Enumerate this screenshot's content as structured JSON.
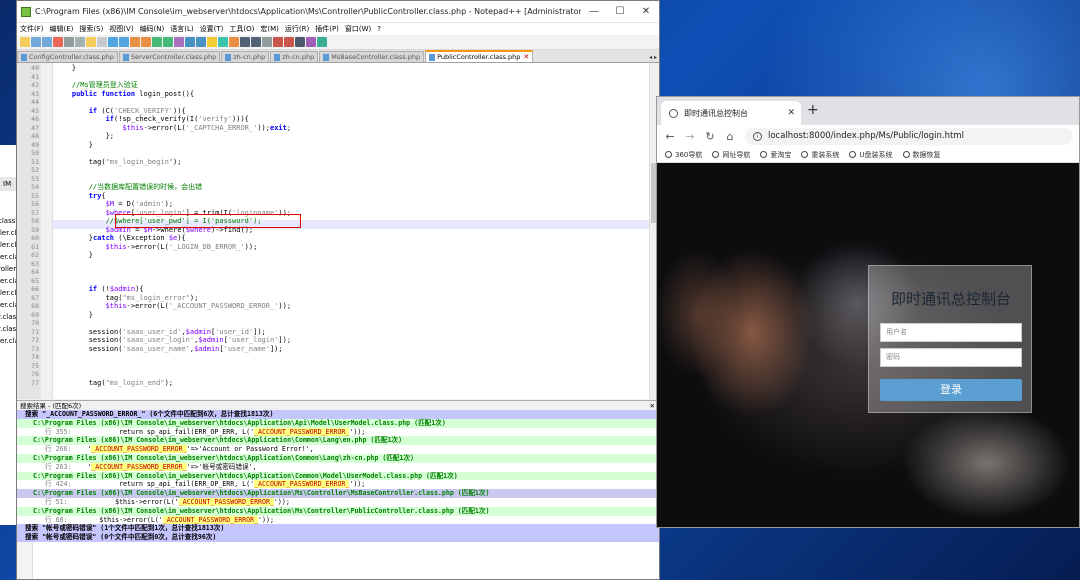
{
  "notepad": {
    "title": "C:\\Program Files (x86)\\IM Console\\im_webserver\\htdocs\\Application\\Ms\\Controller\\PublicController.class.php - Notepad++ [Administrator]",
    "menus": [
      "文件(F)",
      "编辑(E)",
      "搜索(S)",
      "视图(V)",
      "编码(N)",
      "语言(L)",
      "设置(T)",
      "工具(O)",
      "宏(M)",
      "运行(R)",
      "插件(P)",
      "窗口(W)",
      "?"
    ],
    "tabs": [
      "ConfigController.class.php",
      "ServerController.class.php",
      "zh-cn.php",
      "zh-cn.php",
      "MsBaseController.class.php",
      "PublicController.class.php"
    ],
    "tab_nav": "◂ ▸",
    "window_buttons": {
      "minimize": "—",
      "maximize": "☐",
      "close": "✕"
    },
    "code_lines": [
      {
        "n": "40",
        "t": "    }"
      },
      {
        "n": "41",
        "t": ""
      },
      {
        "n": "42",
        "t": "    //Ms管理员登入验证"
      },
      {
        "n": "43",
        "t": "    public function login_post(){"
      },
      {
        "n": "44",
        "t": ""
      },
      {
        "n": "45",
        "t": "        if (C('CHECK_VERIFY')){"
      },
      {
        "n": "46",
        "t": "            if(!sp_check_verify(I('verify'))){"
      },
      {
        "n": "47",
        "t": "                $this->error(L('_CAPTCHA_ERROR_'));exit;"
      },
      {
        "n": "48",
        "t": "            };"
      },
      {
        "n": "49",
        "t": "        }"
      },
      {
        "n": "50",
        "t": ""
      },
      {
        "n": "51",
        "t": "        tag(\"ms_login_begin\");"
      },
      {
        "n": "52",
        "t": ""
      },
      {
        "n": "53",
        "t": ""
      },
      {
        "n": "54",
        "t": "        //当数据库配置错误的时候，会出错"
      },
      {
        "n": "55",
        "t": "        try{"
      },
      {
        "n": "56",
        "t": "            $M = D('admin');"
      },
      {
        "n": "57",
        "t": "            $where['user_login'] = trim(I('loginname'));"
      },
      {
        "n": "58",
        "t": "            //$where['user_pwd'] = I('password');"
      },
      {
        "n": "59",
        "t": "            $admin = $M->where($where)->find();"
      },
      {
        "n": "60",
        "t": "        }catch (\\Exception $e){"
      },
      {
        "n": "61",
        "t": "            $this->error(L('_LOGIN_DB_ERROR_'));"
      },
      {
        "n": "62",
        "t": "        }"
      },
      {
        "n": "63",
        "t": ""
      },
      {
        "n": "64",
        "t": ""
      },
      {
        "n": "65",
        "t": ""
      },
      {
        "n": "66",
        "t": "        if (!$admin){"
      },
      {
        "n": "67",
        "t": "            tag(\"ms_login_error\");"
      },
      {
        "n": "68",
        "t": "            $this->error(L('_ACCOUNT_PASSWORD_ERROR_'));"
      },
      {
        "n": "69",
        "t": "        }"
      },
      {
        "n": "70",
        "t": ""
      },
      {
        "n": "71",
        "t": "        session('saas_user_id',$admin['user_id']);"
      },
      {
        "n": "72",
        "t": "        session('saas_user_login',$admin['user_login']);"
      },
      {
        "n": "73",
        "t": "        session('saas_user_name',$admin['user_name']);"
      },
      {
        "n": "74",
        "t": ""
      },
      {
        "n": "75",
        "t": ""
      },
      {
        "n": "76",
        "t": ""
      },
      {
        "n": "77",
        "t": "        tag(\"ms_login_end\");"
      }
    ],
    "find_panel_title": "搜索结果 - (匹配6次)",
    "find_panel_close": "✕",
    "results": [
      {
        "kind": "search",
        "text": "搜索 \"_ACCOUNT_PASSWORD_ERROR_\" (6个文件中匹配到6次，总计查找1813次)"
      },
      {
        "kind": "file",
        "text": "C:\\Program Files (x86)\\IM Console\\im_webserver\\htdocs\\Application\\Api\\Model\\UserModel.class.php (匹配1次)"
      },
      {
        "kind": "line",
        "lno": "行 355:",
        "pre": "            return sp_api_fail(ERR_OP_ERR, L('",
        "match": "_ACCOUNT_PASSWORD_ERROR_",
        "post": "'));"
      },
      {
        "kind": "file",
        "text": "C:\\Program Files (x86)\\IM Console\\im_webserver\\htdocs\\Application\\Common\\Lang\\en.php (匹配1次)"
      },
      {
        "kind": "line",
        "lno": "行 266:",
        "pre": "    '",
        "match": "_ACCOUNT_PASSWORD_ERROR_",
        "post": "'=>'Account or Password Error!',"
      },
      {
        "kind": "file",
        "text": "C:\\Program Files (x86)\\IM Console\\im_webserver\\htdocs\\Application\\Common\\Lang\\zh-cn.php (匹配1次)"
      },
      {
        "kind": "line",
        "lno": "行 263:",
        "pre": "    '",
        "match": "_ACCOUNT_PASSWORD_ERROR_",
        "post": "'=>'帐号或密码错误',"
      },
      {
        "kind": "file",
        "text": "C:\\Program Files (x86)\\IM Console\\im_webserver\\htdocs\\Application\\Common\\Model\\UserModel.class.php (匹配1次)"
      },
      {
        "kind": "line",
        "lno": "行 424:",
        "pre": "            return sp_api_fail(ERR_OP_ERR, L('",
        "match": "_ACCOUNT_PASSWORD_ERROR_",
        "post": "'));"
      },
      {
        "kind": "file-sel",
        "text": "C:\\Program Files (x86)\\IM Console\\im_webserver\\htdocs\\Application\\Ms\\Controller\\MsBaseController.class.php (匹配1次)"
      },
      {
        "kind": "line",
        "lno": "行 51:",
        "pre": "            $this->error(L('",
        "match": "_ACCOUNT_PASSWORD_ERROR_",
        "post": "'));"
      },
      {
        "kind": "file",
        "text": "C:\\Program Files (x86)\\IM Console\\im_webserver\\htdocs\\Application\\Ms\\Controller\\PublicController.class.php (匹配1次)"
      },
      {
        "kind": "line",
        "lno": "行 68:",
        "pre": "        $this->error(L('",
        "match": "_ACCOUNT_PASSWORD_ERROR_",
        "post": "'));"
      },
      {
        "kind": "search",
        "text": "搜索 \"帐号或密码错误\" (1个文件中匹配到1次，总计查找1813次)"
      },
      {
        "kind": "search",
        "text": "搜索 \"帐号或密码错误\" (0个文件中匹配到0次，总计查找96次)"
      }
    ]
  },
  "background_window": {
    "tab": "IM",
    "rows": [
      "class.",
      "ller.cl",
      "ller.cl",
      "ler.cla",
      "roller.",
      "ler.cla",
      "ller.cl",
      "ler.cla",
      "r.class",
      "r.class",
      "ler.cla"
    ]
  },
  "browser": {
    "tab_title": "即时通讯总控制台",
    "tab_close": "✕",
    "new_tab": "+",
    "nav": {
      "back": "←",
      "forward": "→",
      "reload": "↻",
      "home": "⌂"
    },
    "url": "localhost:8000/index.php/Ms/Public/login.html",
    "bookmarks": [
      "360导航",
      "网址导航",
      "爱淘宝",
      "重装系统",
      "U盘装系统",
      "数据恢复"
    ],
    "login": {
      "title": "即时通讯总控制台",
      "username_placeholder": "用户名",
      "password_placeholder": "密码",
      "button": "登录"
    }
  }
}
